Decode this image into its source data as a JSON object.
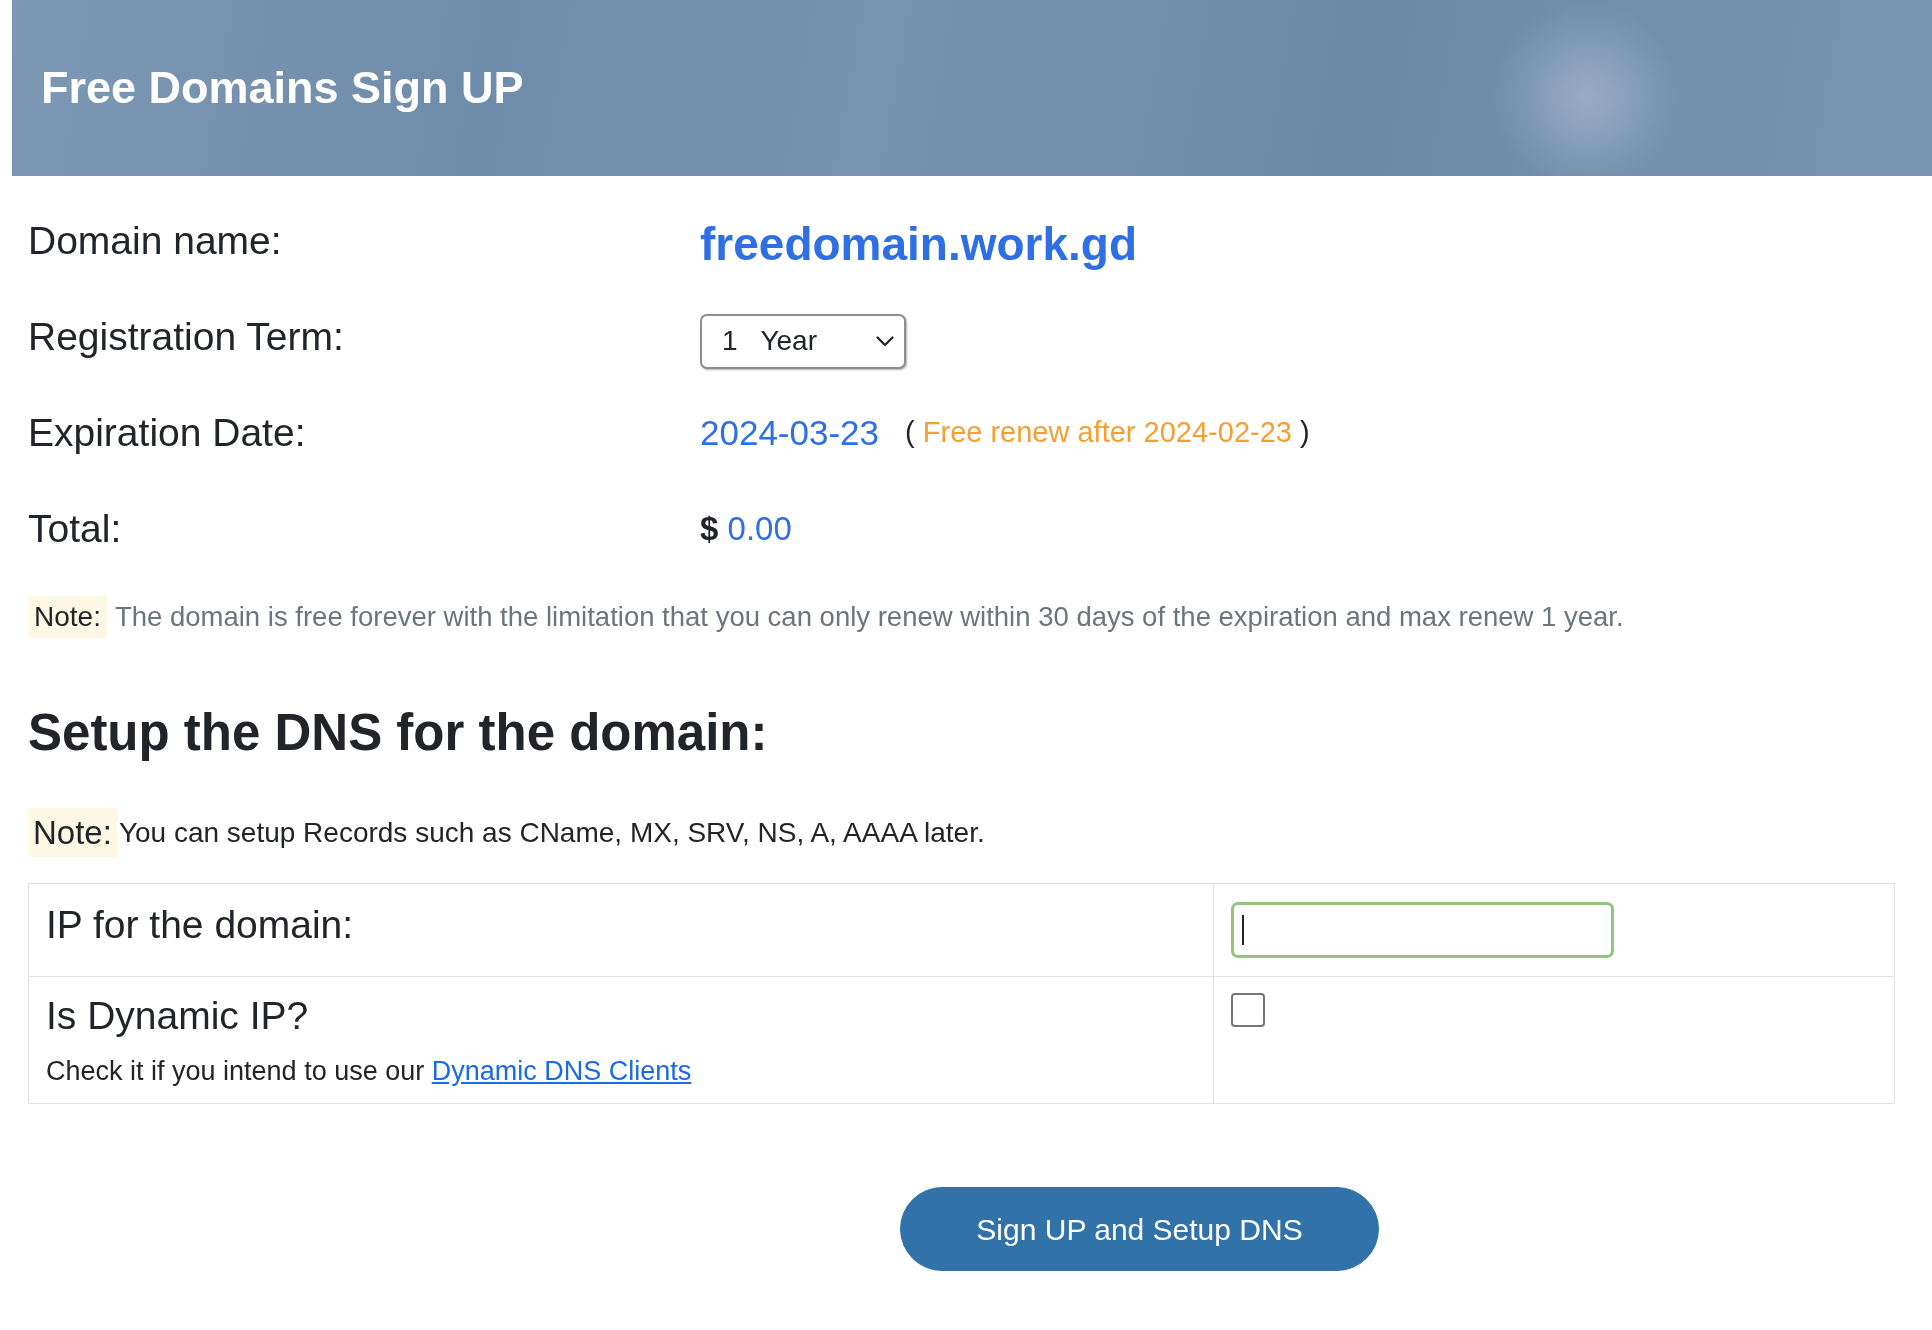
{
  "header": {
    "title": "Free Domains Sign UP"
  },
  "details": [
    {
      "kind": "domain",
      "label": "Domain name:",
      "value": "freedomain.work.gd"
    },
    {
      "kind": "select",
      "label": "Registration Term:",
      "value": "1   Year"
    },
    {
      "kind": "date",
      "label": "Expiration Date:",
      "value": "2024-03-23",
      "renew_note": {
        "open": "(",
        "text": "Free renew after 2024-02-23",
        "close": ")"
      }
    },
    {
      "kind": "total",
      "label": "Total:",
      "currency": "$",
      "value": "0.00"
    }
  ],
  "note": {
    "tag": "Note:",
    "text": "The domain is free forever with the limitation that you can only renew within 30 days of the expiration and max renew 1 year."
  },
  "dns": {
    "heading": "Setup the DNS for the domain:",
    "note": {
      "tag": "Note:",
      "text": "You can setup Records such as CName, MX, SRV, NS, A, AAAA later."
    },
    "fields": [
      {
        "kind": "text",
        "label": "IP for the domain:",
        "focused": true
      },
      {
        "kind": "checkbox",
        "label": "Is Dynamic IP?",
        "hint": "Check it if you intend to use our",
        "link": "Dynamic DNS Clients",
        "checked": false
      }
    ]
  },
  "submit": {
    "label": "Sign UP and Setup DNS"
  }
}
